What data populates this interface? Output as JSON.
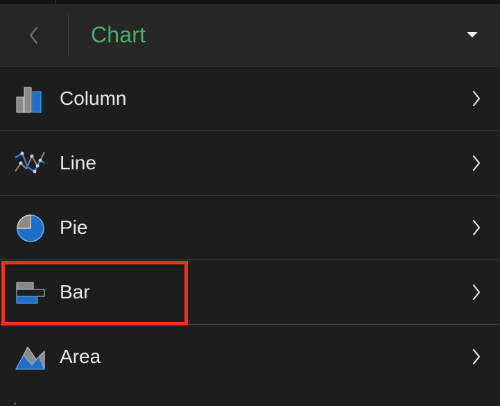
{
  "header": {
    "title": "Chart",
    "back_icon": "chevron-left-icon",
    "menu_icon": "caret-down-icon",
    "title_color": "#4caf6a"
  },
  "chart_types": [
    {
      "label": "Column",
      "icon": "column-chart-icon"
    },
    {
      "label": "Line",
      "icon": "line-chart-icon"
    },
    {
      "label": "Pie",
      "icon": "pie-chart-icon"
    },
    {
      "label": "Bar",
      "icon": "bar-chart-icon",
      "highlighted": true
    },
    {
      "label": "Area",
      "icon": "area-chart-icon"
    }
  ],
  "colors": {
    "accent_blue": "#1f6fc9",
    "icon_gray": "#8c8c8c",
    "highlight": "#f2301c"
  }
}
